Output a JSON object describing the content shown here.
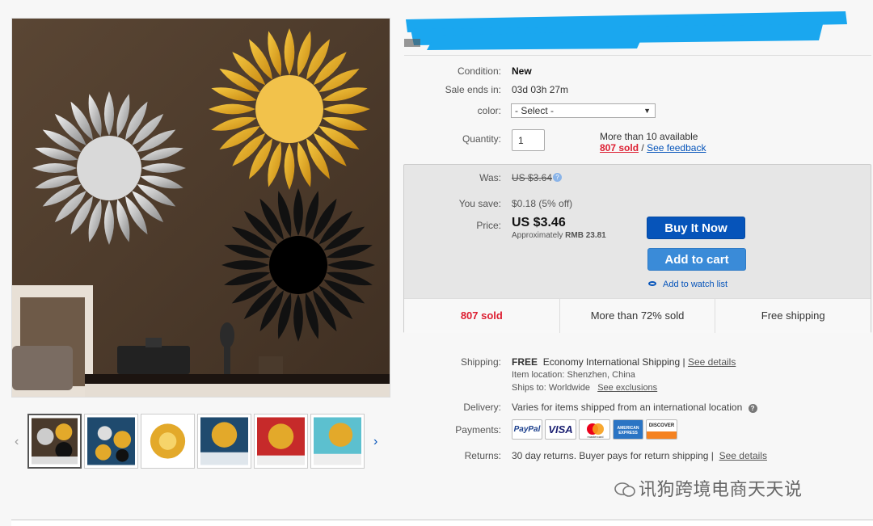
{
  "details": {
    "condition_label": "Condition:",
    "condition_value": "New",
    "sale_ends_label": "Sale ends in:",
    "sale_ends_value": "03d 03h 27m",
    "color_label": "color:",
    "color_select_value": "- Select -",
    "quantity_label": "Quantity:",
    "quantity_value": "1",
    "availability": "More than 10 available",
    "sold_link": "807 sold",
    "separator": "/",
    "feedback_link": "See feedback"
  },
  "price_panel": {
    "was_label": "Was:",
    "was_value": "US $3.64",
    "info_glyph": "?",
    "save_label": "You save:",
    "save_value": "$0.18 (5% off)",
    "price_label": "Price:",
    "price_value": "US $3.46",
    "approx_prefix": "Approximately",
    "approx_value": "RMB 23.81",
    "buy_now": "Buy It Now",
    "add_to_cart": "Add to cart",
    "watch_list": "Add to watch list",
    "footer": [
      "807 sold",
      "More than 72% sold",
      "Free shipping"
    ]
  },
  "shipping": {
    "label": "Shipping:",
    "free": "FREE",
    "service": "Economy International Shipping",
    "pipe": "|",
    "see_details": "See details",
    "location": "Item location:  Shenzhen, China",
    "ships_to_prefix": "Ships to:  Worldwide",
    "see_exclusions": "See exclusions"
  },
  "delivery": {
    "label": "Delivery:",
    "value": "Varies for items shipped from an international location",
    "help_glyph": "?"
  },
  "payments": {
    "label": "Payments:",
    "logos": [
      "PayPal",
      "VISA",
      "mastercard",
      "AMERICAN EXPRESS",
      "DISCOVER"
    ]
  },
  "returns": {
    "label": "Returns:",
    "value": "30 day returns. Buyer pays for return shipping |",
    "link": "See details"
  },
  "gallery": {
    "prev_glyph": "‹",
    "next_glyph": "›",
    "thumbnail_count": 6,
    "active_index": 0
  },
  "watermark": "讯狗跨境电商天天说",
  "colors": {
    "ebay_blue": "#0654ba",
    "cart_blue": "#3a8bd8",
    "sold_red": "#dd1e31",
    "scribble_blue": "#1aa7ef"
  }
}
